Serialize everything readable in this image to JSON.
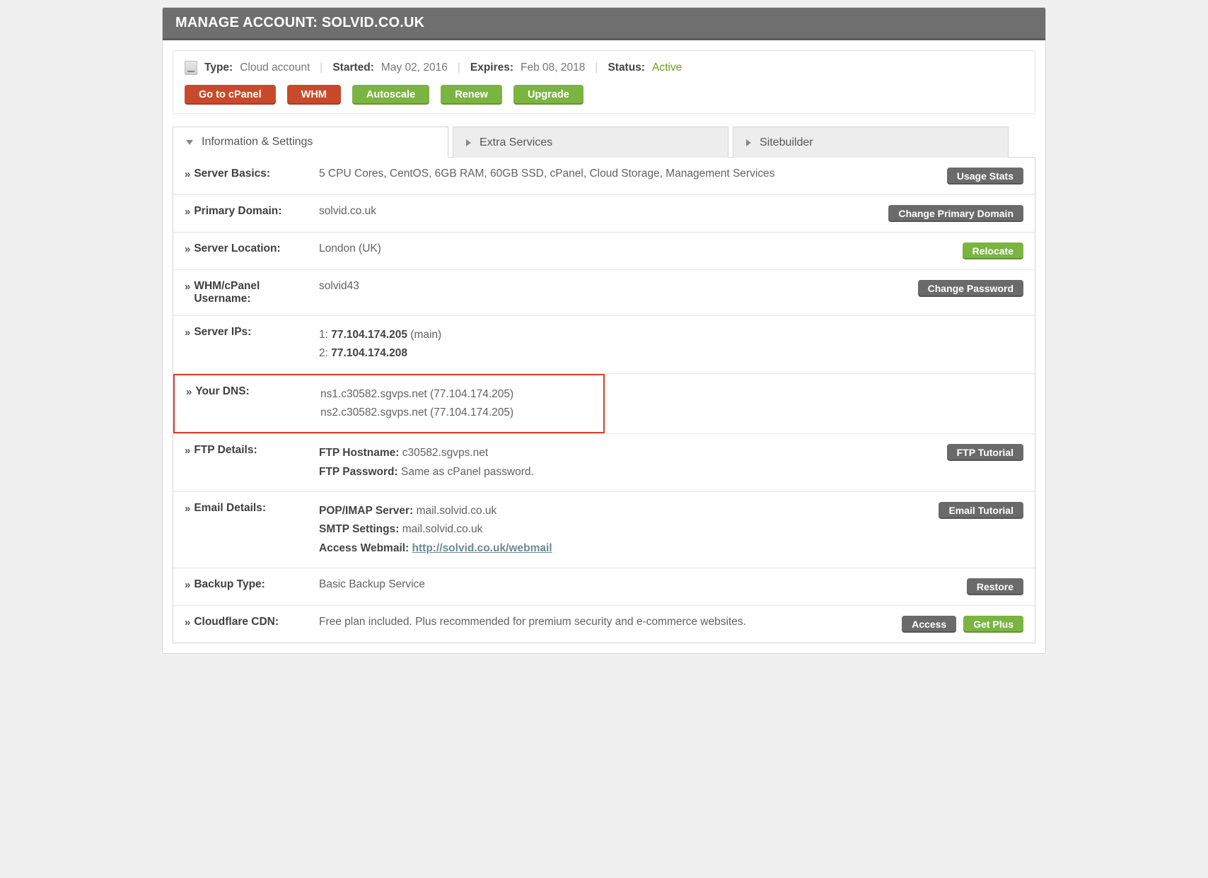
{
  "header": {
    "title": "MANAGE ACCOUNT: SOLVID.CO.UK"
  },
  "summary": {
    "type_label": "Type:",
    "type_value": "Cloud account",
    "started_label": "Started:",
    "started_value": "May 02, 2016",
    "expires_label": "Expires:",
    "expires_value": "Feb 08, 2018",
    "status_label": "Status:",
    "status_value": "Active"
  },
  "buttons": {
    "cpanel": "Go to cPanel",
    "whm": "WHM",
    "autoscale": "Autoscale",
    "renew": "Renew",
    "upgrade": "Upgrade"
  },
  "tabs": {
    "info": "Information & Settings",
    "extra": "Extra Services",
    "sitebuilder": "Sitebuilder"
  },
  "rows": {
    "server_basics": {
      "label": "Server Basics:",
      "value": "5 CPU Cores, CentOS, 6GB RAM, 60GB SSD, cPanel, Cloud Storage, Management Services",
      "action": "Usage Stats"
    },
    "primary_domain": {
      "label": "Primary Domain:",
      "value": "solvid.co.uk",
      "action": "Change Primary Domain"
    },
    "server_location": {
      "label": "Server Location:",
      "value": "London (UK)",
      "action": "Relocate"
    },
    "whm_user": {
      "label": "WHM/cPanel Username:",
      "value": "solvid43",
      "action": "Change Password"
    },
    "server_ips": {
      "label": "Server IPs:",
      "l1a": "1: ",
      "l1b": "77.104.174.205",
      "l1c": " (main)",
      "l2a": "2: ",
      "l2b": "77.104.174.208"
    },
    "dns": {
      "label": "Your DNS:",
      "ns1": "ns1.c30582.sgvps.net (77.104.174.205)",
      "ns2": "ns2.c30582.sgvps.net (77.104.174.205)"
    },
    "ftp": {
      "label": "FTP Details:",
      "host_l": "FTP Hostname: ",
      "host_v": "c30582.sgvps.net",
      "pass_l": "FTP Password: ",
      "pass_v": "Same as cPanel password.",
      "action": "FTP Tutorial"
    },
    "email": {
      "label": "Email Details:",
      "pop_l": "POP/IMAP Server: ",
      "pop_v": "mail.solvid.co.uk",
      "smtp_l": "SMTP Settings: ",
      "smtp_v": "mail.solvid.co.uk",
      "web_l": "Access Webmail:   ",
      "web_link": "http://solvid.co.uk/webmail",
      "action": "Email Tutorial"
    },
    "backup": {
      "label": "Backup Type:",
      "value": "Basic Backup Service",
      "action": "Restore"
    },
    "cdn": {
      "label": "Cloudflare CDN:",
      "value": "Free plan included. Plus recommended for premium security and e-commerce websites.",
      "action1": "Access",
      "action2": "Get Plus"
    }
  }
}
